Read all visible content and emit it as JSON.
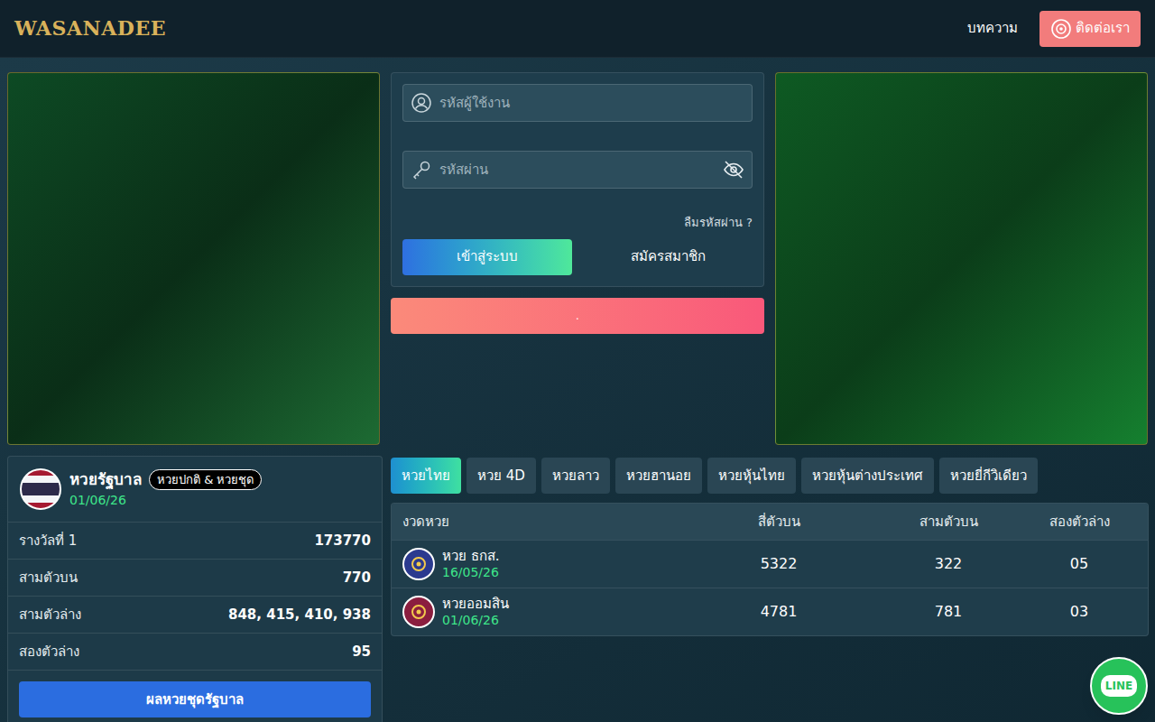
{
  "header": {
    "logo": "WASANADEE",
    "nav": [
      {
        "label": "บทความ"
      }
    ],
    "contact_button": "ติดต่อเรา"
  },
  "login": {
    "username_placeholder": "รหัสผู้ใช้งาน",
    "password_placeholder": "รหัสผ่าน",
    "password_hidden": true,
    "forgot": "ลืมรหัสผ่าน ?",
    "login_button": "เข้าสู่ระบบ",
    "register_button": "สมัครสมาชิก"
  },
  "notice_bar": ".",
  "government": {
    "title": "หวยรัฐบาล",
    "badge": "หวยปกติ & หวยชุด",
    "date": "01/06/26",
    "rows": [
      {
        "label": "รางวัลที่ 1",
        "value": "173770"
      },
      {
        "label": "สามตัวบน",
        "value": "770"
      },
      {
        "label": "สามตัวล่าง",
        "value": "848, 415, 410, 938"
      },
      {
        "label": "สองตัวล่าง",
        "value": "95"
      }
    ],
    "button": "ผลหวยชุดรัฐบาล"
  },
  "tabs": [
    {
      "label": "หวยไทย",
      "selected": true
    },
    {
      "label": "หวย 4D",
      "selected": false
    },
    {
      "label": "หวยลาว",
      "selected": false
    },
    {
      "label": "หวยฮานอย",
      "selected": false
    },
    {
      "label": "หวยหุ้นไทย",
      "selected": false
    },
    {
      "label": "หวยหุ้นต่างประเทศ",
      "selected": false
    },
    {
      "label": "หวยยี่กีวิเดียว",
      "selected": false
    }
  ],
  "table": {
    "columns": [
      "งวดหวย",
      "สี่ตัวบน",
      "สามตัวบน",
      "สองตัวล่าง"
    ],
    "rows": [
      {
        "name": "หวย ธกส.",
        "date": "16/05/26",
        "four": "5322",
        "three": "322",
        "two": "05",
        "color": "#2b3a8f"
      },
      {
        "name": "หวยออมสิน",
        "date": "01/06/26",
        "four": "4781",
        "three": "781",
        "two": "03",
        "color": "#8b1e3f"
      }
    ]
  },
  "line_button": "LINE"
}
